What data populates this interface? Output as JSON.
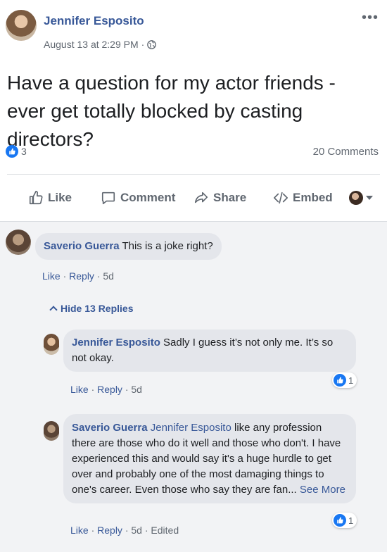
{
  "post": {
    "author": "Jennifer Esposito",
    "timestamp": "August 13 at 2:29 PM",
    "separator": "·",
    "audience_icon": "globe-icon",
    "more_icon": "ellipsis-icon",
    "text": "Have a question for my actor friends - ever get totally blocked by casting directors?",
    "reaction_count": "3",
    "comments_count": "20 Comments"
  },
  "actions": {
    "like": "Like",
    "comment": "Comment",
    "share": "Share",
    "embed": "Embed"
  },
  "comments": [
    {
      "author": "Saverio Guerra",
      "text": "This is a joke right?",
      "like": "Like",
      "reply": "Reply",
      "time": "5d"
    }
  ],
  "hide_replies": "Hide 13 Replies",
  "replies": [
    {
      "author": "Jennifer Esposito",
      "text": "Sadly I guess it’s not only me. It’s so not okay.",
      "like": "Like",
      "reply": "Reply",
      "time": "5d",
      "reaction_count": "1"
    },
    {
      "author": "Saverio Guerra",
      "mention": "Jennifer Esposito",
      "text": "like any profession there are those who do it well and those who don't. I have experienced this and would say it's a huge hurdle to get over and probably one of the most damaging things to one's career. Even those who say they are fan...",
      "see_more": "See More",
      "like": "Like",
      "reply": "Reply",
      "time": "5d",
      "edited": "Edited",
      "reaction_count": "1"
    }
  ],
  "colors": {
    "link": "#385898",
    "like_blue": "#1877f2",
    "bubble": "#e4e6eb",
    "secondary_text": "#606770"
  }
}
